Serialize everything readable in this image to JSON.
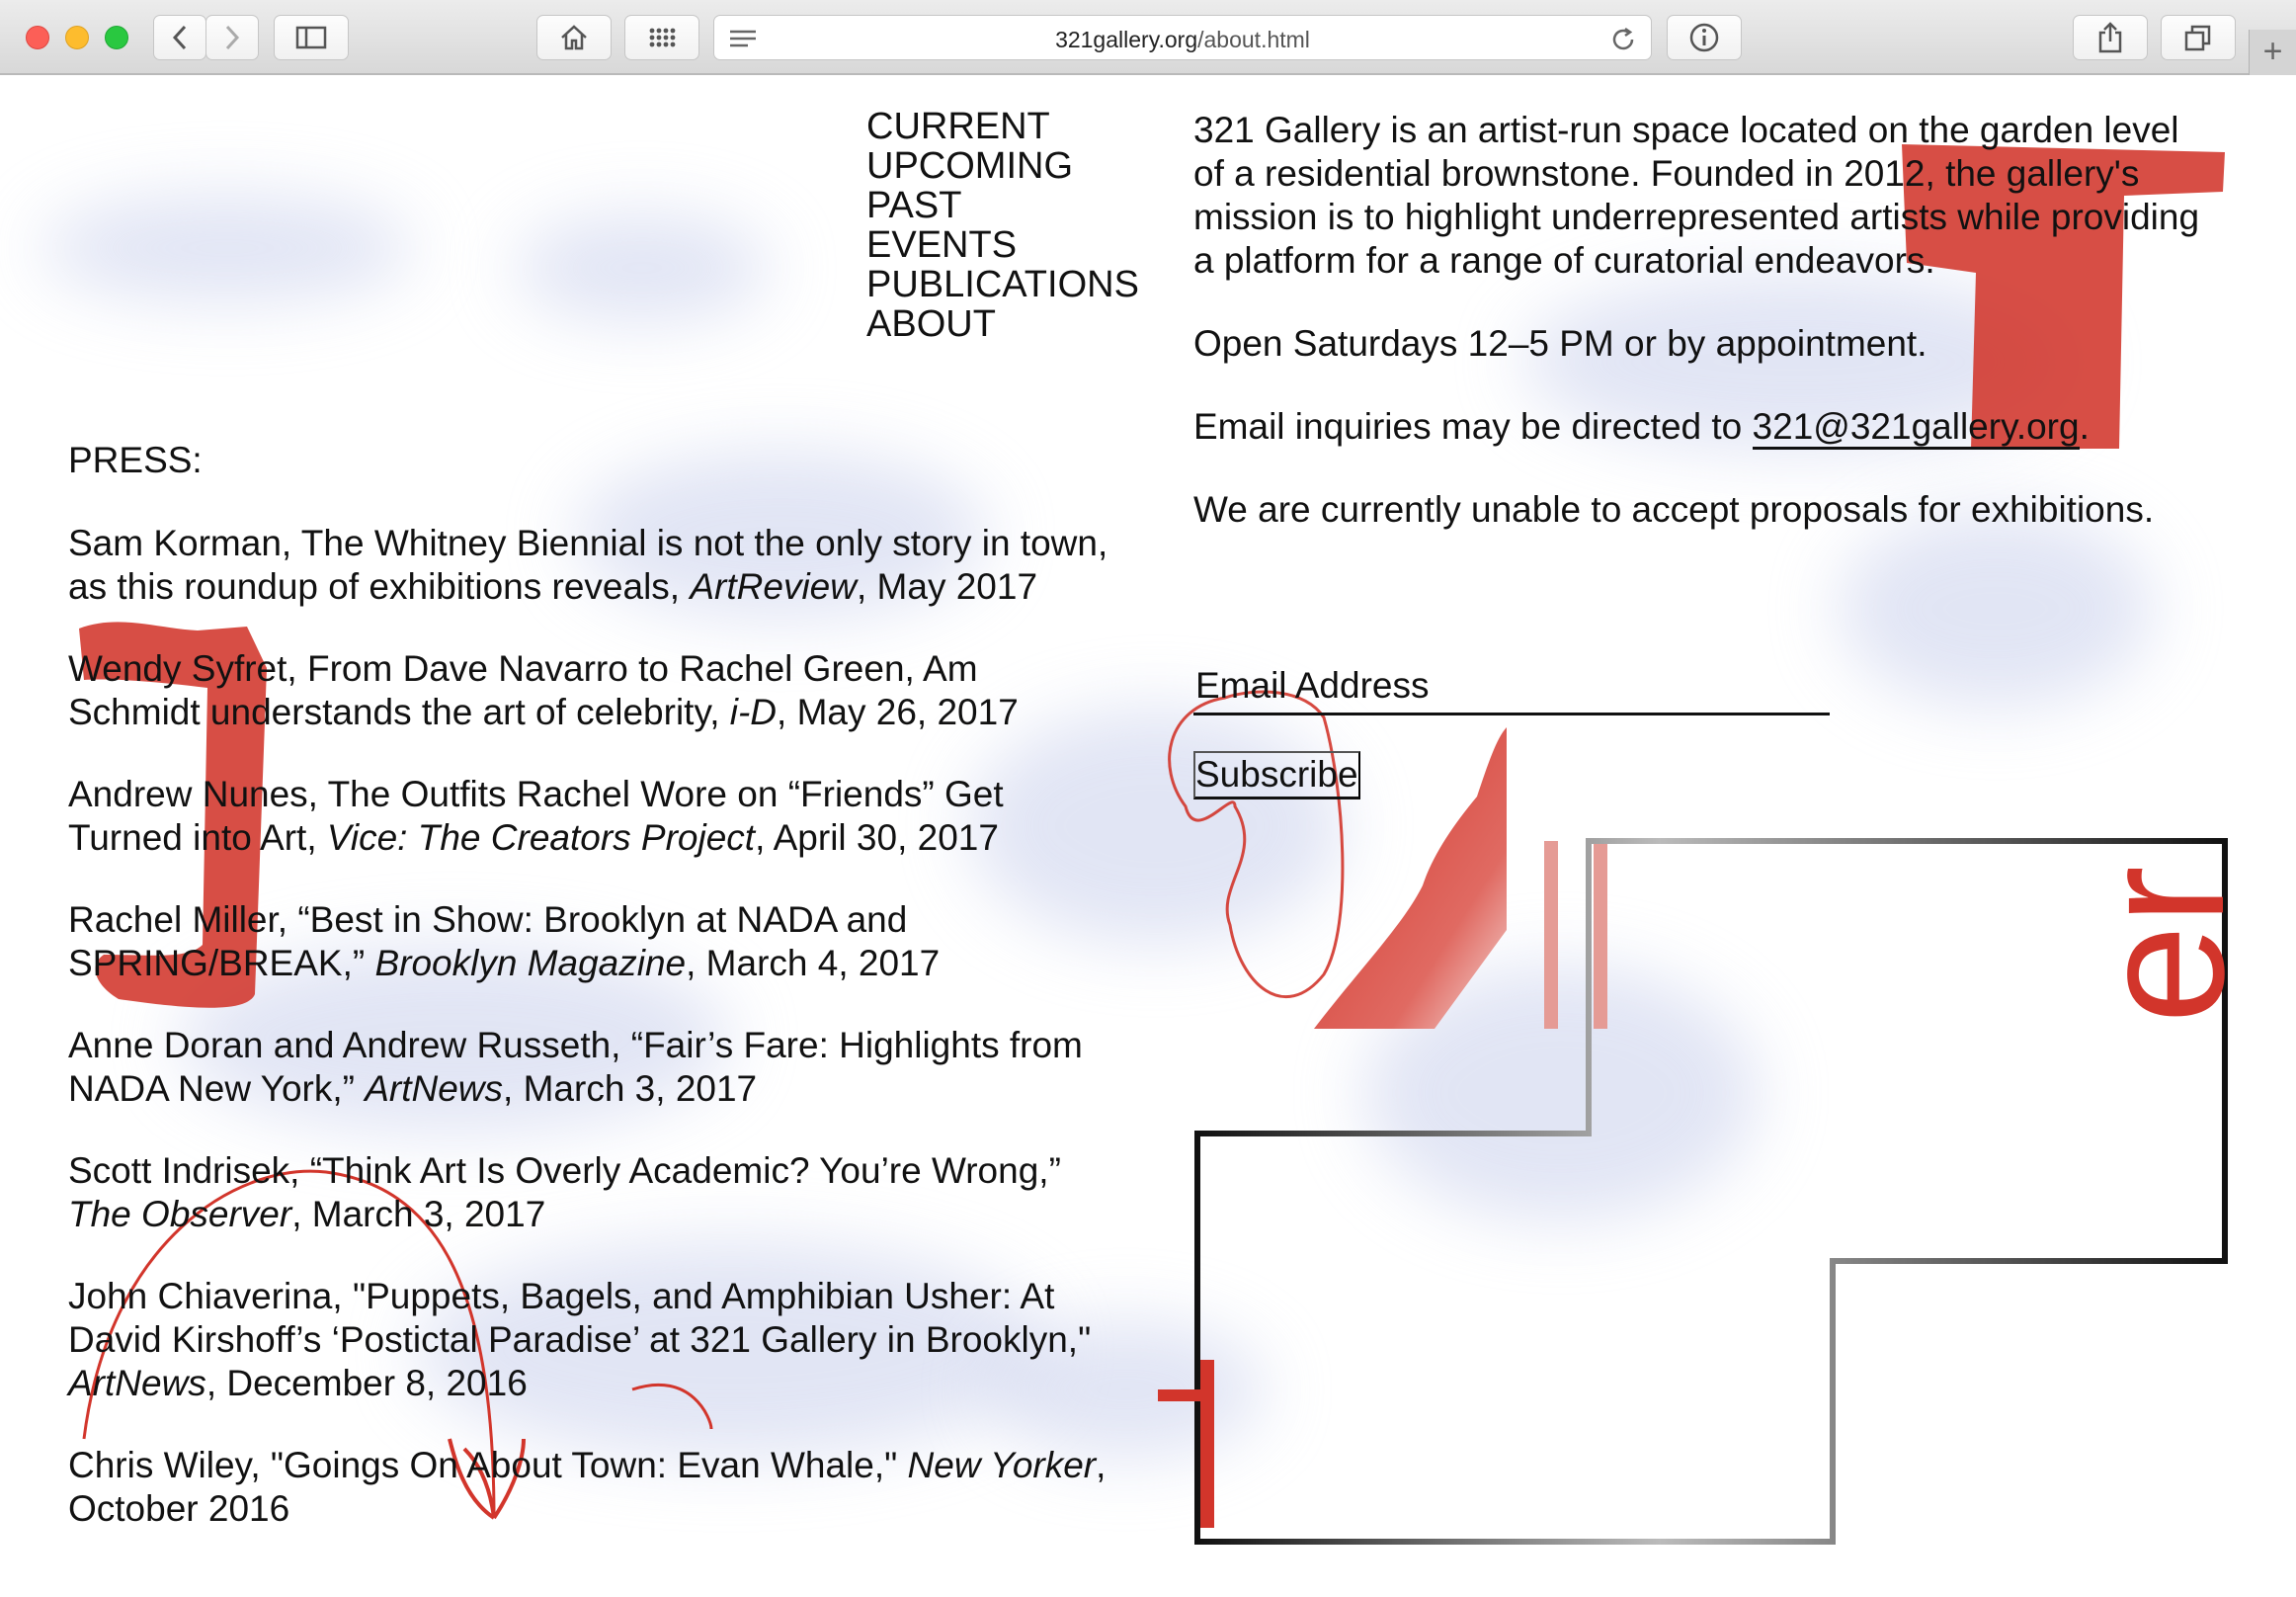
{
  "browser": {
    "url_domain": "321gallery.org",
    "url_path": "/about.html",
    "new_tab_symbol": "+"
  },
  "nav": {
    "items": [
      "CURRENT",
      "UPCOMING",
      "PAST",
      "EVENTS",
      "PUBLICATIONS",
      "ABOUT"
    ]
  },
  "press": {
    "heading": "PRESS:",
    "items": [
      {
        "before": "Sam Korman, The Whitney Biennial is not the only story in town, as this roundup of exhibitions reveals, ",
        "italic": "ArtReview",
        "after": ", May 2017"
      },
      {
        "before": "Wendy Syfret, From Dave Navarro to Rachel Green, Am Schmidt understands the art of celebrity, ",
        "italic": "i-D",
        "after": ", May 26, 2017"
      },
      {
        "before": "Andrew Nunes, The Outfits Rachel Wore on “Friends” Get Turned into Art, ",
        "italic": "Vice: The Creators Project",
        "after": ", April 30, 2017"
      },
      {
        "before": "Rachel Miller, “Best in Show: Brooklyn at NADA and SPRING/BREAK,” ",
        "italic": "Brooklyn Magazine",
        "after": ", March 4, 2017"
      },
      {
        "before": "Anne Doran and Andrew Russeth, “Fair’s Fare: Highlights from NADA New York,” ",
        "italic": "ArtNews",
        "after": ", March 3, 2017"
      },
      {
        "before": "Scott Indrisek, “Think Art Is Overly Academic? You’re Wrong,” ",
        "italic": "The Observer",
        "after": ", March 3, 2017"
      },
      {
        "before": "John Chiaverina, \"Puppets, Bagels, and Amphibian Usher: At David Kirshoff’s ‘Postictal Paradise’ at 321 Gallery in Brooklyn,\" ",
        "italic": "ArtNews",
        "after": ", December 8, 2016"
      },
      {
        "before": "Chris Wiley, \"Goings On About Town: Evan Whale,\" ",
        "italic": "New Yorker",
        "after": ", October 2016"
      }
    ]
  },
  "about": {
    "intro": "321 Gallery is an artist-run space located on the garden level of a residential brownstone. Founded in 2012, the gallery's mission is to highlight underrepresented artists while providing a platform for a range of curatorial endeavors.",
    "hours": "Open Saturdays 12–5 PM or by appointment.",
    "email_prefix": "Email inquiries may be directed to ",
    "email": "321@321gallery.org",
    "email_suffix": ".",
    "proposals": "We are currently unable to accept proposals for exhibitions."
  },
  "newsletter": {
    "placeholder": "Email Address",
    "button": "Subscribe"
  },
  "colors": {
    "accent_red": "#d2352b",
    "blob_blue": "#c9d0ec"
  },
  "art": {
    "logo_letters": "er"
  }
}
